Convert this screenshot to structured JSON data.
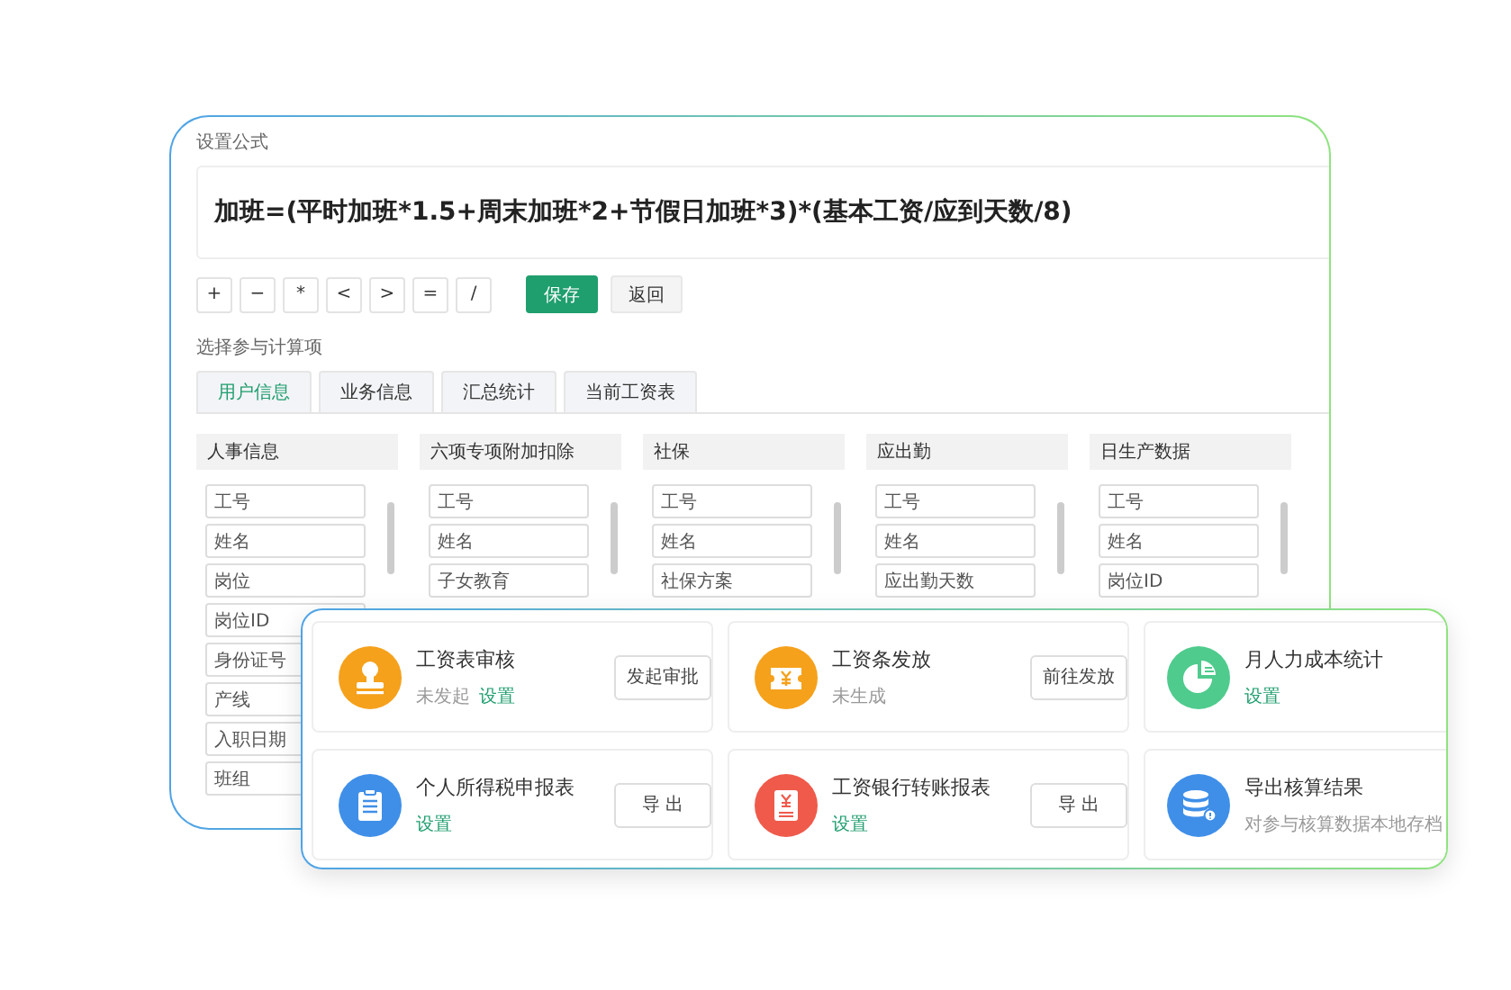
{
  "formula_window": {
    "title": "设置公式",
    "formula": "加班=(平时加班*1.5+周末加班*2+节假日加班*3)*(基本工资/应到天数/8)",
    "operators": [
      "+",
      "−",
      "*",
      "<",
      ">",
      "=",
      "/"
    ],
    "actions": [
      {
        "label": "保存",
        "kind": "primary"
      },
      {
        "label": "返回",
        "kind": "secondary"
      }
    ],
    "section_label": "选择参与计算项",
    "tabs": [
      {
        "label": "用户信息",
        "selected": true
      },
      {
        "label": "业务信息",
        "selected": false
      },
      {
        "label": "汇总统计",
        "selected": false
      },
      {
        "label": "当前工资表",
        "selected": false
      }
    ],
    "columns": [
      {
        "title": "人事信息",
        "fields": [
          "工号",
          "姓名",
          "岗位",
          "岗位ID",
          "身份证号",
          "产线",
          "入职日期",
          "班组"
        ]
      },
      {
        "title": "六项专项附加扣除",
        "fields": [
          "工号",
          "姓名",
          "子女教育"
        ]
      },
      {
        "title": "社保",
        "fields": [
          "工号",
          "姓名",
          "社保方案"
        ]
      },
      {
        "title": "应出勤",
        "fields": [
          "工号",
          "姓名",
          "应出勤天数"
        ]
      },
      {
        "title": "日生产数据",
        "fields": [
          "工号",
          "姓名",
          "岗位ID"
        ]
      }
    ]
  },
  "tasks_window": {
    "cards": [
      {
        "kind": "stamp",
        "color": "#f5a11c",
        "title": "工资表审核",
        "status": "未发起",
        "link": "设置",
        "button": "发起审批"
      },
      {
        "kind": "ticket",
        "color": "#f5a11c",
        "title": "工资条发放",
        "status": "未生成",
        "button": "前往发放"
      },
      {
        "kind": "pie",
        "color": "#4fcb8d",
        "title": "月人力成本统计",
        "link": "设置"
      },
      {
        "kind": "clipboard",
        "color": "#3f8fe8",
        "title": "个人所得税申报表",
        "link": "设置",
        "button": "导 出"
      },
      {
        "kind": "bill",
        "color": "#ef5a4b",
        "title": "工资银行转账报表",
        "link": "设置",
        "button": "导 出"
      },
      {
        "kind": "database",
        "color": "#3f8fe8",
        "title": "导出核算结果",
        "status": "对参与核算数据本地存档"
      }
    ]
  }
}
